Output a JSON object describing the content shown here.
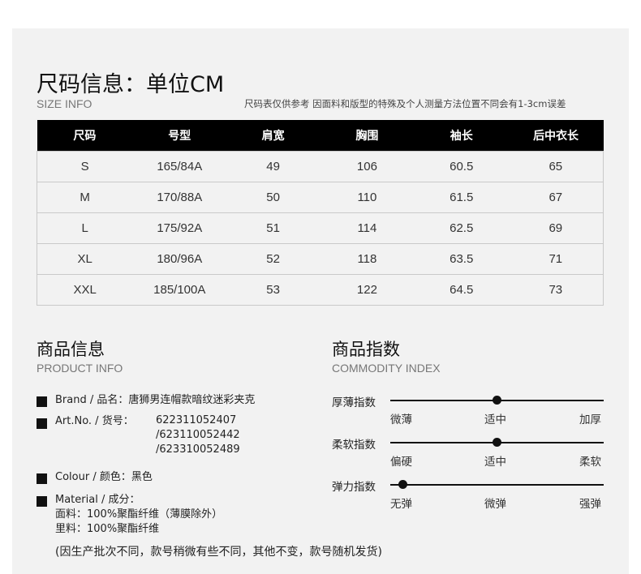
{
  "size_info": {
    "title": "尺码信息：单位CM",
    "subtitle_en": "SIZE INFO",
    "note": "尺码表仅供参考 因面料和版型的特殊及个人测量方法位置不同会有1-3cm误差",
    "headers": [
      "尺码",
      "号型",
      "肩宽",
      "胸围",
      "袖长",
      "后中衣长"
    ],
    "rows": [
      [
        "S",
        "165/84A",
        "49",
        "106",
        "60.5",
        "65"
      ],
      [
        "M",
        "170/88A",
        "50",
        "110",
        "61.5",
        "67"
      ],
      [
        "L",
        "175/92A",
        "51",
        "114",
        "62.5",
        "69"
      ],
      [
        "XL",
        "180/96A",
        "52",
        "118",
        "63.5",
        "71"
      ],
      [
        "XXL",
        "185/100A",
        "53",
        "122",
        "64.5",
        "73"
      ]
    ]
  },
  "product_info": {
    "title": "商品信息",
    "subtitle_en": "PRODUCT INFO",
    "brand": "Brand / 品名：唐狮男连帽款暗纹迷彩夹克",
    "art_label": "Art.No. / 货号：",
    "art_numbers": [
      "622311052407",
      "/623110052442",
      "/623310052489"
    ],
    "colour": "Colour / 颜色：黑色",
    "material_label": "Material / 成分：",
    "material_lines": [
      "面料：100%聚酯纤维（薄膜除外）",
      "里料：100%聚酯纤维"
    ],
    "disclaimer": "(因生产批次不同，款号稍微有些不同，其他不变，款号随机发货)"
  },
  "commodity_index": {
    "title": "商品指数",
    "subtitle_en": "COMMODITY INDEX",
    "indices": [
      {
        "label": "厚薄指数",
        "options": [
          "微薄",
          "适中",
          "加厚"
        ],
        "selected": "适中"
      },
      {
        "label": "柔软指数",
        "options": [
          "偏硬",
          "适中",
          "柔软"
        ],
        "selected": "适中"
      },
      {
        "label": "弹力指数",
        "options": [
          "无弹",
          "微弹",
          "强弹"
        ],
        "selected": "无弹"
      }
    ]
  }
}
